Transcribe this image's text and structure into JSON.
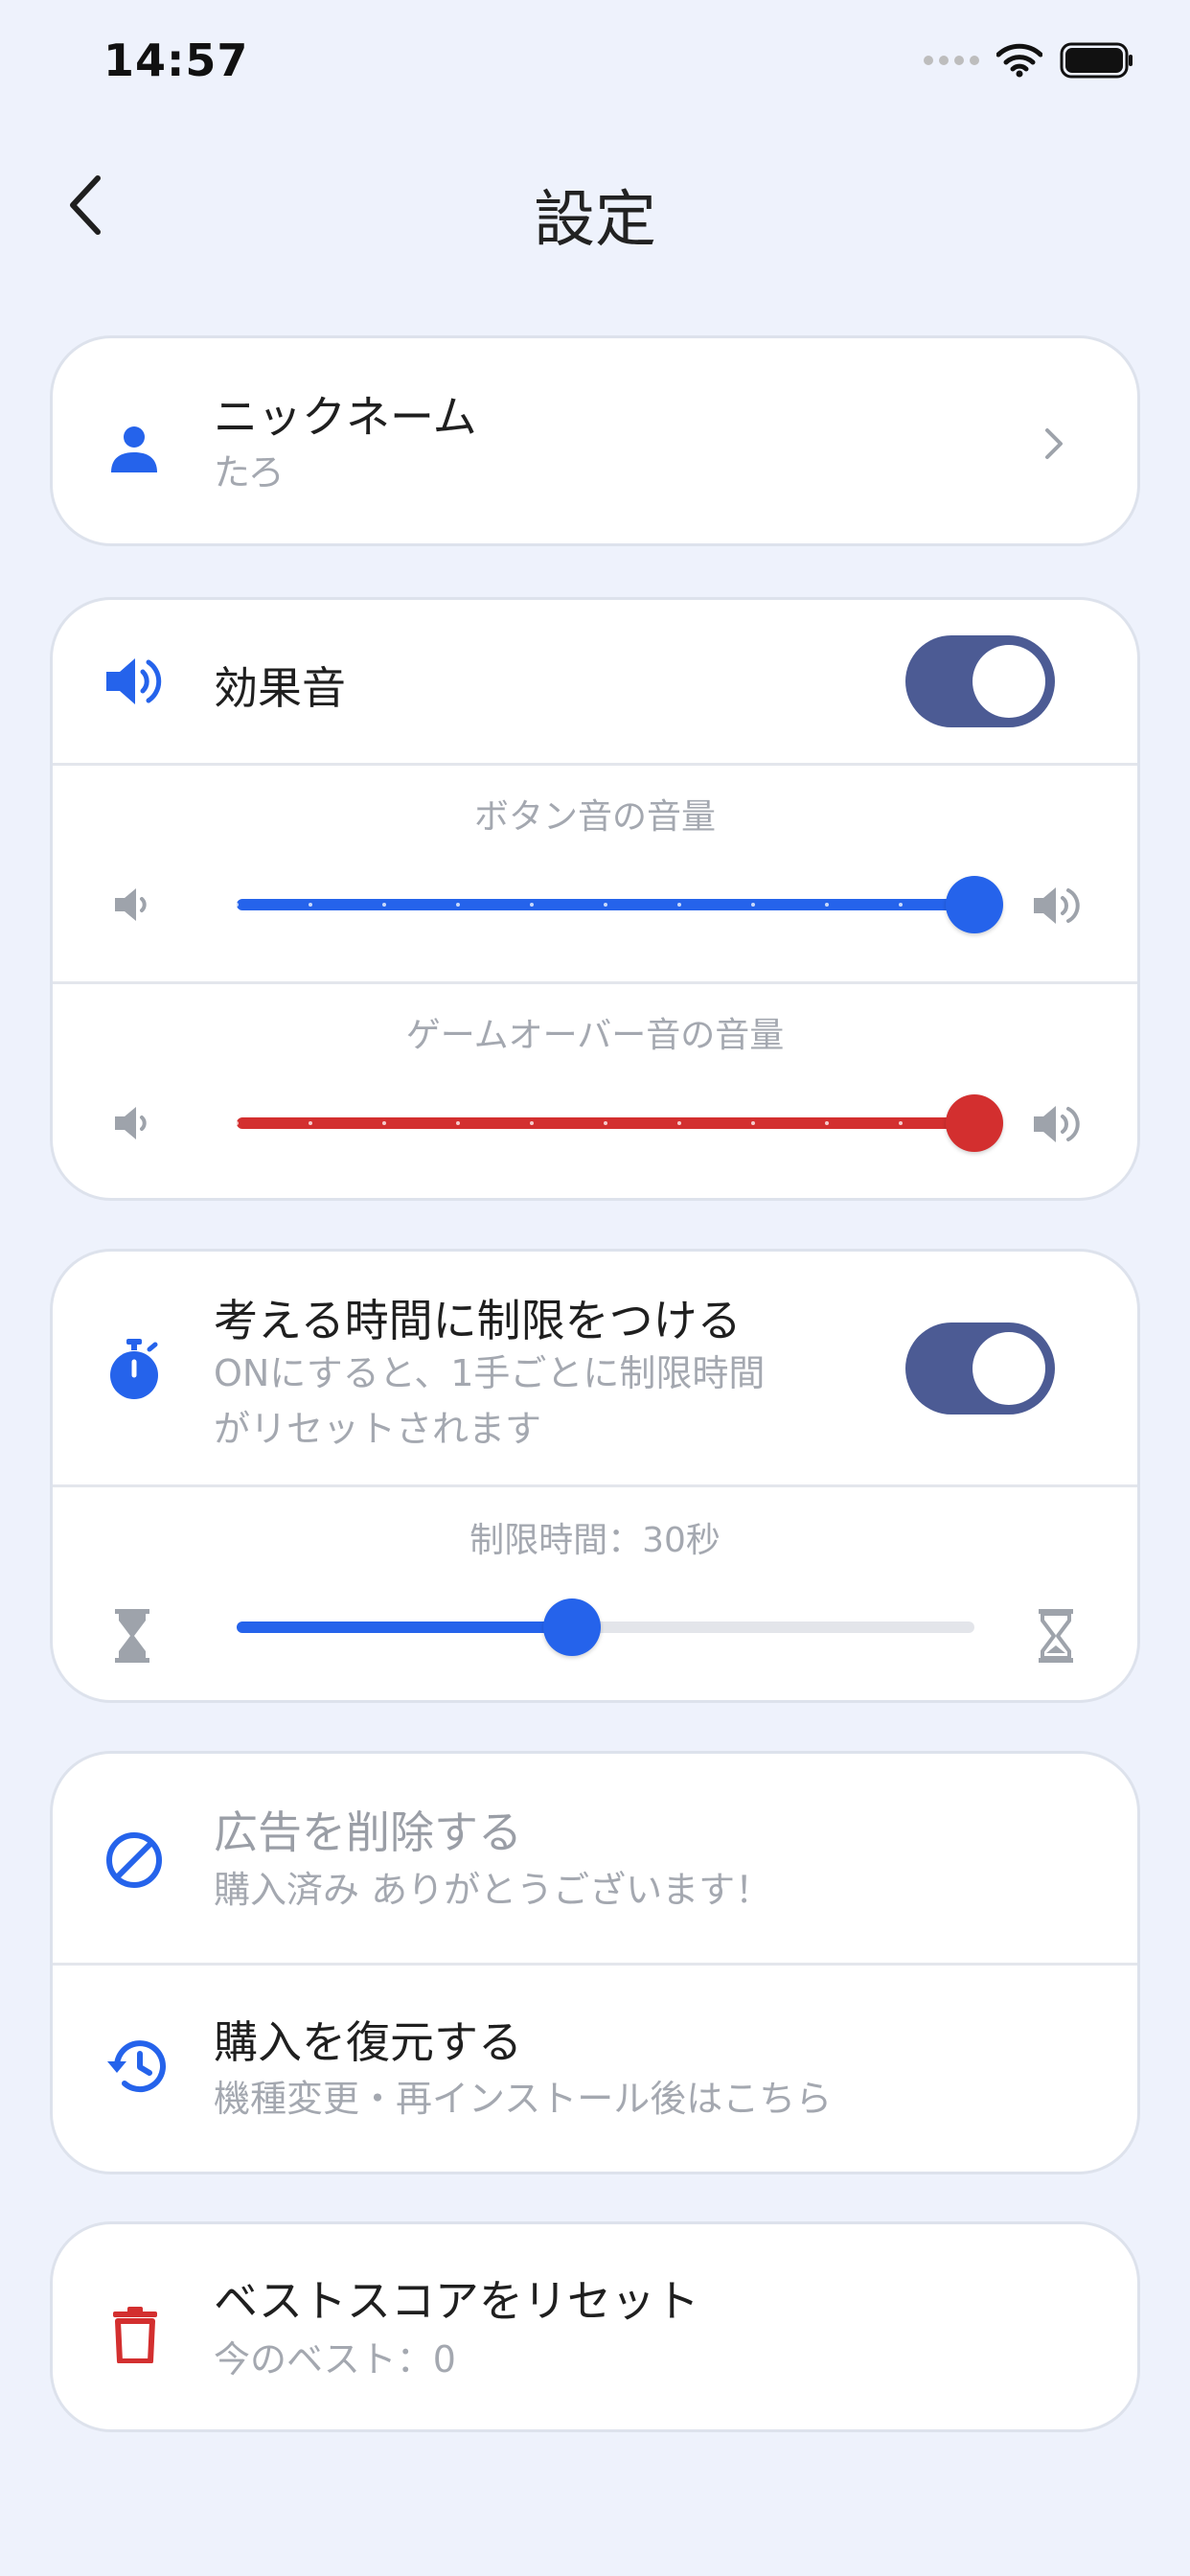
{
  "status_bar": {
    "time": "14:57"
  },
  "nav": {
    "title": "設定"
  },
  "nickname": {
    "title": "ニックネーム",
    "value": "たろ"
  },
  "sound": {
    "title": "効果音",
    "enabled": true,
    "button_volume": {
      "caption": "ボタン音の音量",
      "level": 1.0
    },
    "gameover_volume": {
      "caption": "ゲームオーバー音の音量",
      "level": 1.0
    }
  },
  "time_limit": {
    "title": "考える時間に制限をつける",
    "description_line1": "ONにすると、1手ごとに制限時間",
    "description_line2": "がリセットされます",
    "enabled": true,
    "caption": "制限時間：30秒",
    "level": 0.455
  },
  "purchases": {
    "remove_ads": {
      "title": "広告を削除する",
      "subtitle": "購入済み ありがとうございます！"
    },
    "restore": {
      "title": "購入を復元する",
      "subtitle": "機種変更・再インストール後はこちら"
    }
  },
  "best_score": {
    "title": "ベストスコアをリセット",
    "subtitle": "今のベスト：0"
  },
  "colors": {
    "accent_blue": "#2563EB",
    "danger_red": "#D32F2F",
    "toggle_on": "#4C5B94",
    "background": "#EEF2FC"
  }
}
